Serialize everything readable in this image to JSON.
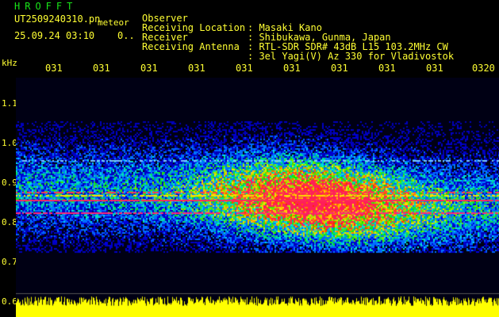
{
  "header": {
    "app_title": "HROFFT",
    "filename": "UT2509240310.pn",
    "filename_suffix": "meteor",
    "datetime": "25.09.24 03:10    0..",
    "info": [
      {
        "label": "Observer",
        "value": ": Masaki Kano"
      },
      {
        "label": "Receiving Location",
        "value": ": Shibukawa, Gunma, Japan"
      },
      {
        "label": "Receiver",
        "value": ": RTL-SDR SDR# 43dB L15 103.2MHz CW"
      },
      {
        "label": "Receiving Antenna",
        "value": ": 3el Yagi(V) Az 330 for Vladivostok"
      }
    ]
  },
  "axes": {
    "freq_unit": "kHz",
    "time_ticks": [
      "031",
      "031",
      "031",
      "031",
      "031",
      "031",
      "031",
      "031",
      "031",
      "0320"
    ],
    "freq_ticks": [
      "1.1",
      "1.0",
      "0.9",
      "0.8",
      "0.7",
      "0.6"
    ]
  },
  "colors": {
    "text_yellow": "#ffff33",
    "title_green": "#19e619",
    "background": "#000000"
  }
}
